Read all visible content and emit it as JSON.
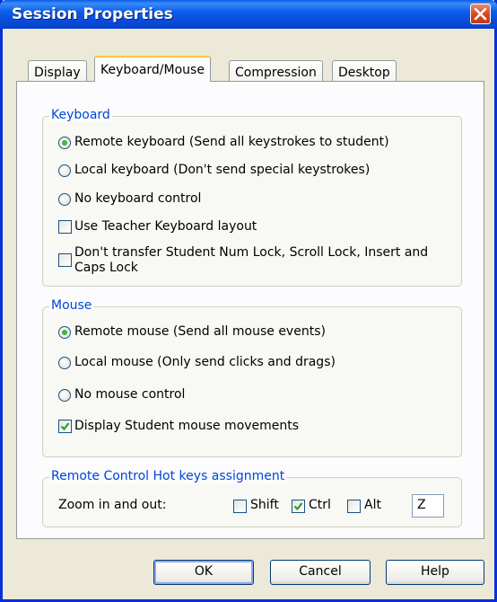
{
  "window": {
    "title": "Session Properties"
  },
  "tabs": [
    {
      "label": "Display"
    },
    {
      "label": "Keyboard/Mouse"
    },
    {
      "label": "Compression"
    },
    {
      "label": "Desktop"
    }
  ],
  "keyboard": {
    "legend": "Keyboard",
    "options": [
      {
        "label": "Remote keyboard (Send all keystrokes to student)",
        "selected": true
      },
      {
        "label": "Local keyboard (Don't send special keystrokes)",
        "selected": false
      },
      {
        "label": "No keyboard control",
        "selected": false
      }
    ],
    "use_teacher_layout": {
      "label": "Use Teacher Keyboard layout",
      "checked": false
    },
    "dont_transfer_locks": {
      "label_line1": "Don't transfer Student Num Lock, Scroll Lock, Insert and",
      "label_line2": "Caps Lock",
      "checked": false
    }
  },
  "mouse": {
    "legend": "Mouse",
    "options": [
      {
        "label": "Remote mouse (Send all mouse events)",
        "selected": true
      },
      {
        "label": "Local mouse (Only send clicks and drags)",
        "selected": false
      },
      {
        "label": "No mouse control",
        "selected": false
      }
    ],
    "display_movements": {
      "label": "Display Student mouse movements",
      "checked": true
    }
  },
  "hotkeys": {
    "legend": "Remote Control Hot keys assignment",
    "zoom_label": "Zoom in and out:",
    "shift": {
      "label": "Shift",
      "checked": false
    },
    "ctrl": {
      "label": "Ctrl",
      "checked": true
    },
    "alt": {
      "label": "Alt",
      "checked": false
    },
    "key_value": "Z"
  },
  "buttons": {
    "ok": "OK",
    "cancel": "Cancel",
    "help": "Help"
  }
}
